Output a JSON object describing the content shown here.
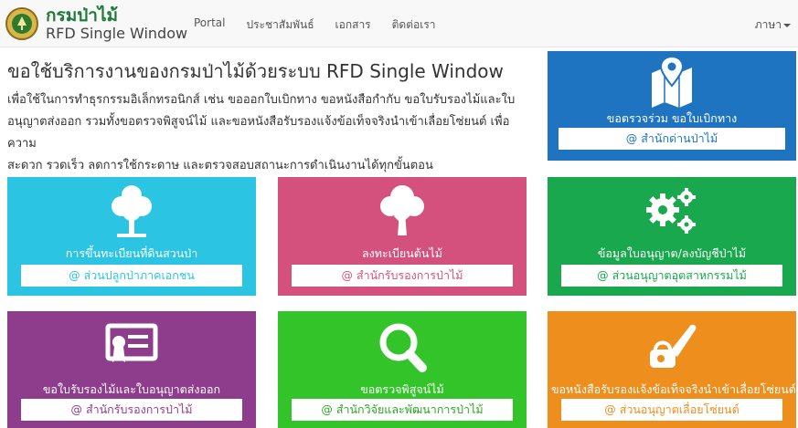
{
  "header": {
    "brand_title": "กรมป่าไม้",
    "brand_subtitle": "RFD Single Window",
    "nav": [
      "Portal",
      "ประชาสัมพันธ์",
      "เอกสาร",
      "ติดต่อเรา"
    ],
    "language": "ภาษา"
  },
  "intro": {
    "heading": "ขอใช้บริการงานของกรมป่าไม้ด้วยระบบ RFD Single Window",
    "line1": "เพื่อใช้ในการทำธุรกรรมอิเล็กทรอนิกส์ เช่น ขอออกใบเบิกทาง ขอหนังสือกำกับ ขอใบรับรองไม้และใบ",
    "line2": "อนุญาตส่งออก รวมทั้งขอตรวจพิสูจน์ไม้ และขอหนังสือรับรองแจ้งข้อเท็จจริงนำเข้าเลื่อยโซ่ยนต์ เพื่อความ",
    "line3": "สะดวก รวดเร็ว ลดการใช้กระดาษ และตรวจสอบสถานะการดำเนินงานได้ทุกขั้นตอน"
  },
  "tiles": [
    {
      "title": "ขอตรวจร่วม ขอใบเบิกทาง",
      "button": "@ สำนักด่านป่าไม้",
      "color": "#1e74c1",
      "icon": "map-pin-icon"
    },
    {
      "title": "การขึ้นทะเบียนที่ดินสวนป่า",
      "button": "@ ส่วนปลูกป่าภาคเอกชน",
      "color": "#2cc4e3",
      "icon": "forest-trees-icon"
    },
    {
      "title": "ลงทะเบียนต้นไม้",
      "button": "@ สำนักรับรองการป่าไม้",
      "color": "#d4517d",
      "icon": "tree-icon"
    },
    {
      "title": "ข้อมูลใบอนุญาต/ลงบัญชีป่าไม้",
      "button": "@ ส่วนอนุญาตอุตสาหกรรมไม้",
      "color": "#19a84d",
      "icon": "gears-icon"
    },
    {
      "title": "ขอใบรับรองไม้และใบอนุญาตส่งออก",
      "button": "@ สำนักรับรองการป่าไม้",
      "color": "#8e3c8c",
      "icon": "certificate-icon"
    },
    {
      "title": "ขอตรวจพิสูจน์ไม้",
      "button": "@ สำนักวิจัยและพัฒนาการป่าไม้",
      "color": "#33c42a",
      "icon": "magnifier-icon"
    },
    {
      "title": "ขอหนังสือรับรองแจ้งข้อเท็จจริงนำเข้าเลื่อยโซ่ยนต์",
      "button": "@ ส่วนอนุญาตเลื่อยโซ่ยนต์",
      "color": "#ee8e1d",
      "icon": "chainsaw-icon"
    }
  ]
}
